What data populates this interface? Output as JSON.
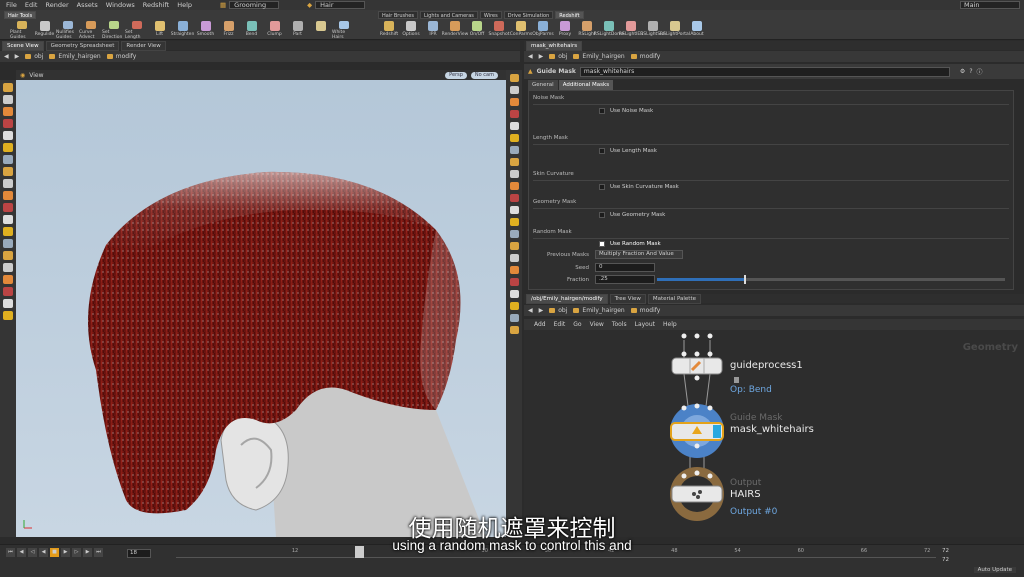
{
  "menubar": {
    "items": [
      "File",
      "Edit",
      "Render",
      "Assets",
      "Windows",
      "Redshift",
      "Help"
    ],
    "workspace": "Grooming",
    "context": "Hair",
    "right_label": "Main"
  },
  "shelf": {
    "left_tab": "Hair Tools",
    "right_tabs": [
      "Hair Brushes",
      "Lights and Cameras",
      "Wires",
      "Drive Simulation",
      "Redshift"
    ],
    "left_tools": [
      "Plant Guides",
      "Regulide",
      "Nullifies Guides",
      "Curve Advect",
      "Set Direction",
      "Set Length",
      "Lift",
      "Straighten",
      "Smooth",
      "Frizz",
      "Bend",
      "Clump",
      "Part",
      "",
      "White Hairs"
    ],
    "right_tools": [
      "Redshift",
      "Options",
      "IPR",
      "RenderView",
      "On/Off",
      "Snapshot",
      "ConParms",
      "ObjParms",
      "Proxy",
      "RSLight",
      "RSLightDome",
      "RSLightIES",
      "RSLightSun",
      "RSLightPortal",
      "About"
    ]
  },
  "left_pane": {
    "tabs": [
      "Scene View",
      "Geometry Spreadsheet",
      "Render View"
    ],
    "path": [
      "obj",
      "Emily_hairgen",
      "modify"
    ],
    "view_title": "View",
    "persp": "Persp",
    "cam": "No cam"
  },
  "parm_pane": {
    "tab": "mask_whitehairs",
    "path": [
      "obj",
      "Emily_hairgen",
      "modify"
    ],
    "node_type": "Guide Mask",
    "node_name": "mask_whitehairs",
    "tabs": [
      "General",
      "Additional Masks"
    ],
    "sections": [
      {
        "title": "Noise Mask",
        "check": "Use Noise Mask",
        "on": false
      },
      {
        "title": "Length Mask",
        "check": "Use Length Mask",
        "on": false
      },
      {
        "title": "Skin Curvature",
        "check": "Use Skin Curvature Mask",
        "on": false
      },
      {
        "title": "Geometry Mask",
        "check": "Use Geometry Mask",
        "on": false
      },
      {
        "title": "Random Mask",
        "check": "Use Random Mask",
        "on": true
      }
    ],
    "previous_masks_label": "Previous Masks",
    "previous_masks_value": "Multiply Fraction And Value",
    "seed_label": "Seed",
    "seed_value": "0",
    "fraction_label": "Fraction",
    "fraction_value": ".25",
    "fraction_level": 0.25
  },
  "net_pane": {
    "tabs": [
      "/obj/Emily_hairgen/modify",
      "Tree View",
      "Material Palette"
    ],
    "path": [
      "obj",
      "Emily_hairgen",
      "modify"
    ],
    "menu": [
      "Add",
      "Edit",
      "Go",
      "View",
      "Tools",
      "Layout",
      "Help"
    ],
    "context": "Geometry",
    "nodes": [
      {
        "name": "guideprocess1",
        "sub": "Op: Bend",
        "type": ""
      },
      {
        "name": "mask_whitehairs",
        "sub": "",
        "type": "Guide Mask"
      },
      {
        "name": "HAIRS",
        "sub": "Output #0",
        "type": "Output"
      }
    ]
  },
  "playbar": {
    "frame": "18",
    "ticks": [
      "12",
      "18",
      "24",
      "30",
      "36",
      "42",
      "48",
      "54",
      "60",
      "66",
      "72"
    ],
    "end": "72",
    "end2": "72",
    "auto_update": "Auto Update"
  },
  "subtitles": {
    "zh": "使用随机遮罩来控制",
    "en": "using a random mask to control this and"
  },
  "colors": {
    "accent": "#e39b1a",
    "node_blue": "#6ea7e0",
    "hair_red": "#7a1812"
  }
}
